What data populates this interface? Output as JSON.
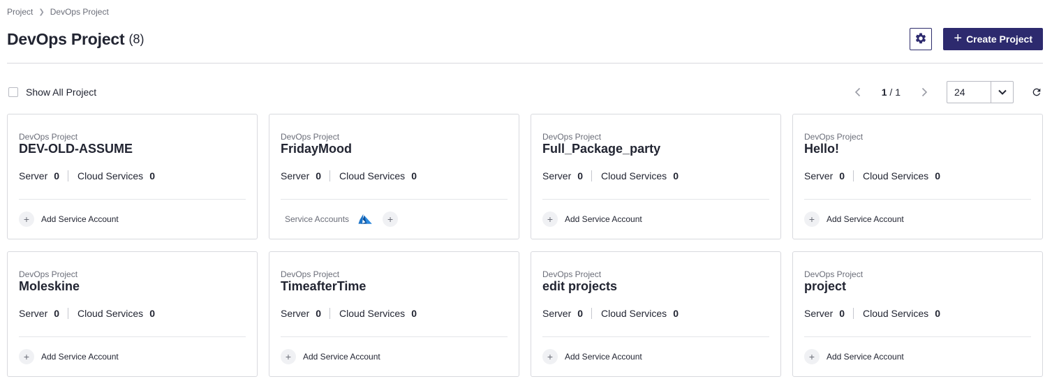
{
  "breadcrumb": {
    "items": [
      "Project",
      "DevOps Project"
    ],
    "separator": ">"
  },
  "header": {
    "title": "DevOps Project",
    "count": "(8)",
    "create_label": "Create Project"
  },
  "toolbar": {
    "show_all_label": "Show All Project",
    "show_all_checked": false,
    "page_current": "1",
    "page_sep": " / ",
    "page_total": "1",
    "page_size": "24"
  },
  "labels": {
    "server": "Server",
    "cloud_services": "Cloud Services",
    "add_service_account": "Add Service Account",
    "service_accounts": "Service Accounts"
  },
  "colors": {
    "primary": "#2d2a6e",
    "azure": "#0f6cbd"
  },
  "cards": [
    {
      "group": "DevOps Project",
      "name": "DEV-OLD-ASSUME",
      "server": "0",
      "cloud_services": "0",
      "has_accounts": false
    },
    {
      "group": "DevOps Project",
      "name": "FridayMood",
      "server": "0",
      "cloud_services": "0",
      "has_accounts": true,
      "account_icon": "azure-icon"
    },
    {
      "group": "DevOps Project",
      "name": "Full_Package_party",
      "server": "0",
      "cloud_services": "0",
      "has_accounts": false
    },
    {
      "group": "DevOps Project",
      "name": "Hello!",
      "server": "0",
      "cloud_services": "0",
      "has_accounts": false
    },
    {
      "group": "DevOps Project",
      "name": "Moleskine",
      "server": "0",
      "cloud_services": "0",
      "has_accounts": false
    },
    {
      "group": "DevOps Project",
      "name": "TimeafterTime",
      "server": "0",
      "cloud_services": "0",
      "has_accounts": false
    },
    {
      "group": "DevOps Project",
      "name": "edit projects",
      "server": "0",
      "cloud_services": "0",
      "has_accounts": false
    },
    {
      "group": "DevOps Project",
      "name": "project",
      "server": "0",
      "cloud_services": "0",
      "has_accounts": false
    }
  ]
}
